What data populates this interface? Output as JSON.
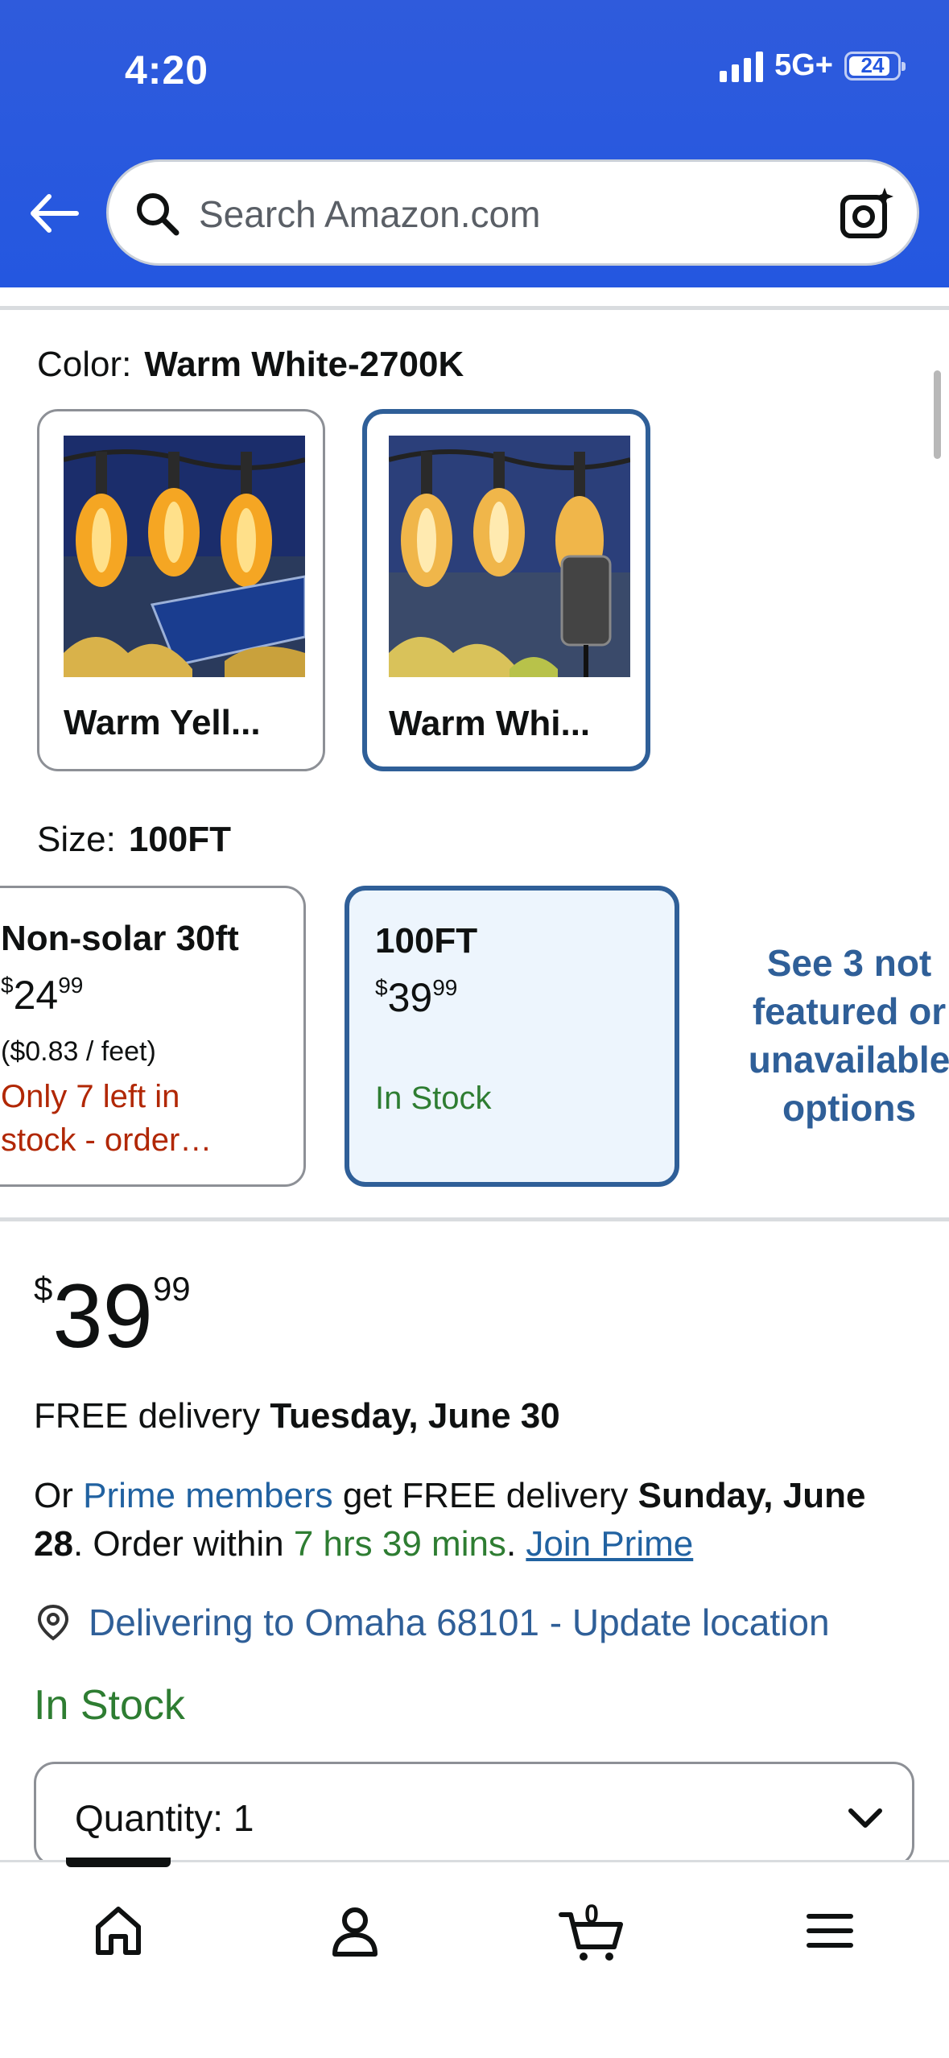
{
  "status_bar": {
    "time": "4:20",
    "network": "5G+",
    "battery": "24"
  },
  "search": {
    "placeholder": "Search Amazon.com"
  },
  "color": {
    "label": "Color:",
    "selected": "Warm White-2700K",
    "options": [
      {
        "name": "Warm Yell...",
        "selected": false
      },
      {
        "name": "Warm Whi...",
        "selected": true
      }
    ]
  },
  "size": {
    "label": "Size:",
    "selected": "100FT",
    "options": [
      {
        "title": "Non-solar 30ft",
        "price_whole": "24",
        "price_frac": "99",
        "unit_price": "($0.83 / feet)",
        "stock_line1": "Only 7 left in",
        "stock_line2": "stock - order…"
      },
      {
        "title": "100FT",
        "price_whole": "39",
        "price_frac": "99",
        "stock": "In Stock"
      }
    ],
    "see_more": "See 3 not featured or unavailable options"
  },
  "price": {
    "symbol": "$",
    "whole": "39",
    "fraction": "99"
  },
  "delivery": {
    "line1_prefix": "FREE delivery ",
    "line1_date": "Tuesday, June 30",
    "prime_or": "Or ",
    "prime_link": "Prime members",
    "prime_mid": " get FREE delivery ",
    "prime_date": "Sunday, June 28",
    "order_within": ". Order within ",
    "countdown": "7 hrs 39 mins",
    "period": ". ",
    "join_prime": "Join Prime"
  },
  "location": {
    "text": "Delivering to Omaha 68101 - Update location"
  },
  "availability": "In Stock",
  "quantity": {
    "label": "Quantity:",
    "value": "1"
  },
  "bottom_nav": {
    "cart_count": "0"
  },
  "colors": {
    "header_blue": "#2457e0",
    "selected_border": "#2f5f98",
    "link_blue": "#2162a1",
    "in_stock_green": "#2e7d32",
    "low_stock_red": "#b12704"
  }
}
